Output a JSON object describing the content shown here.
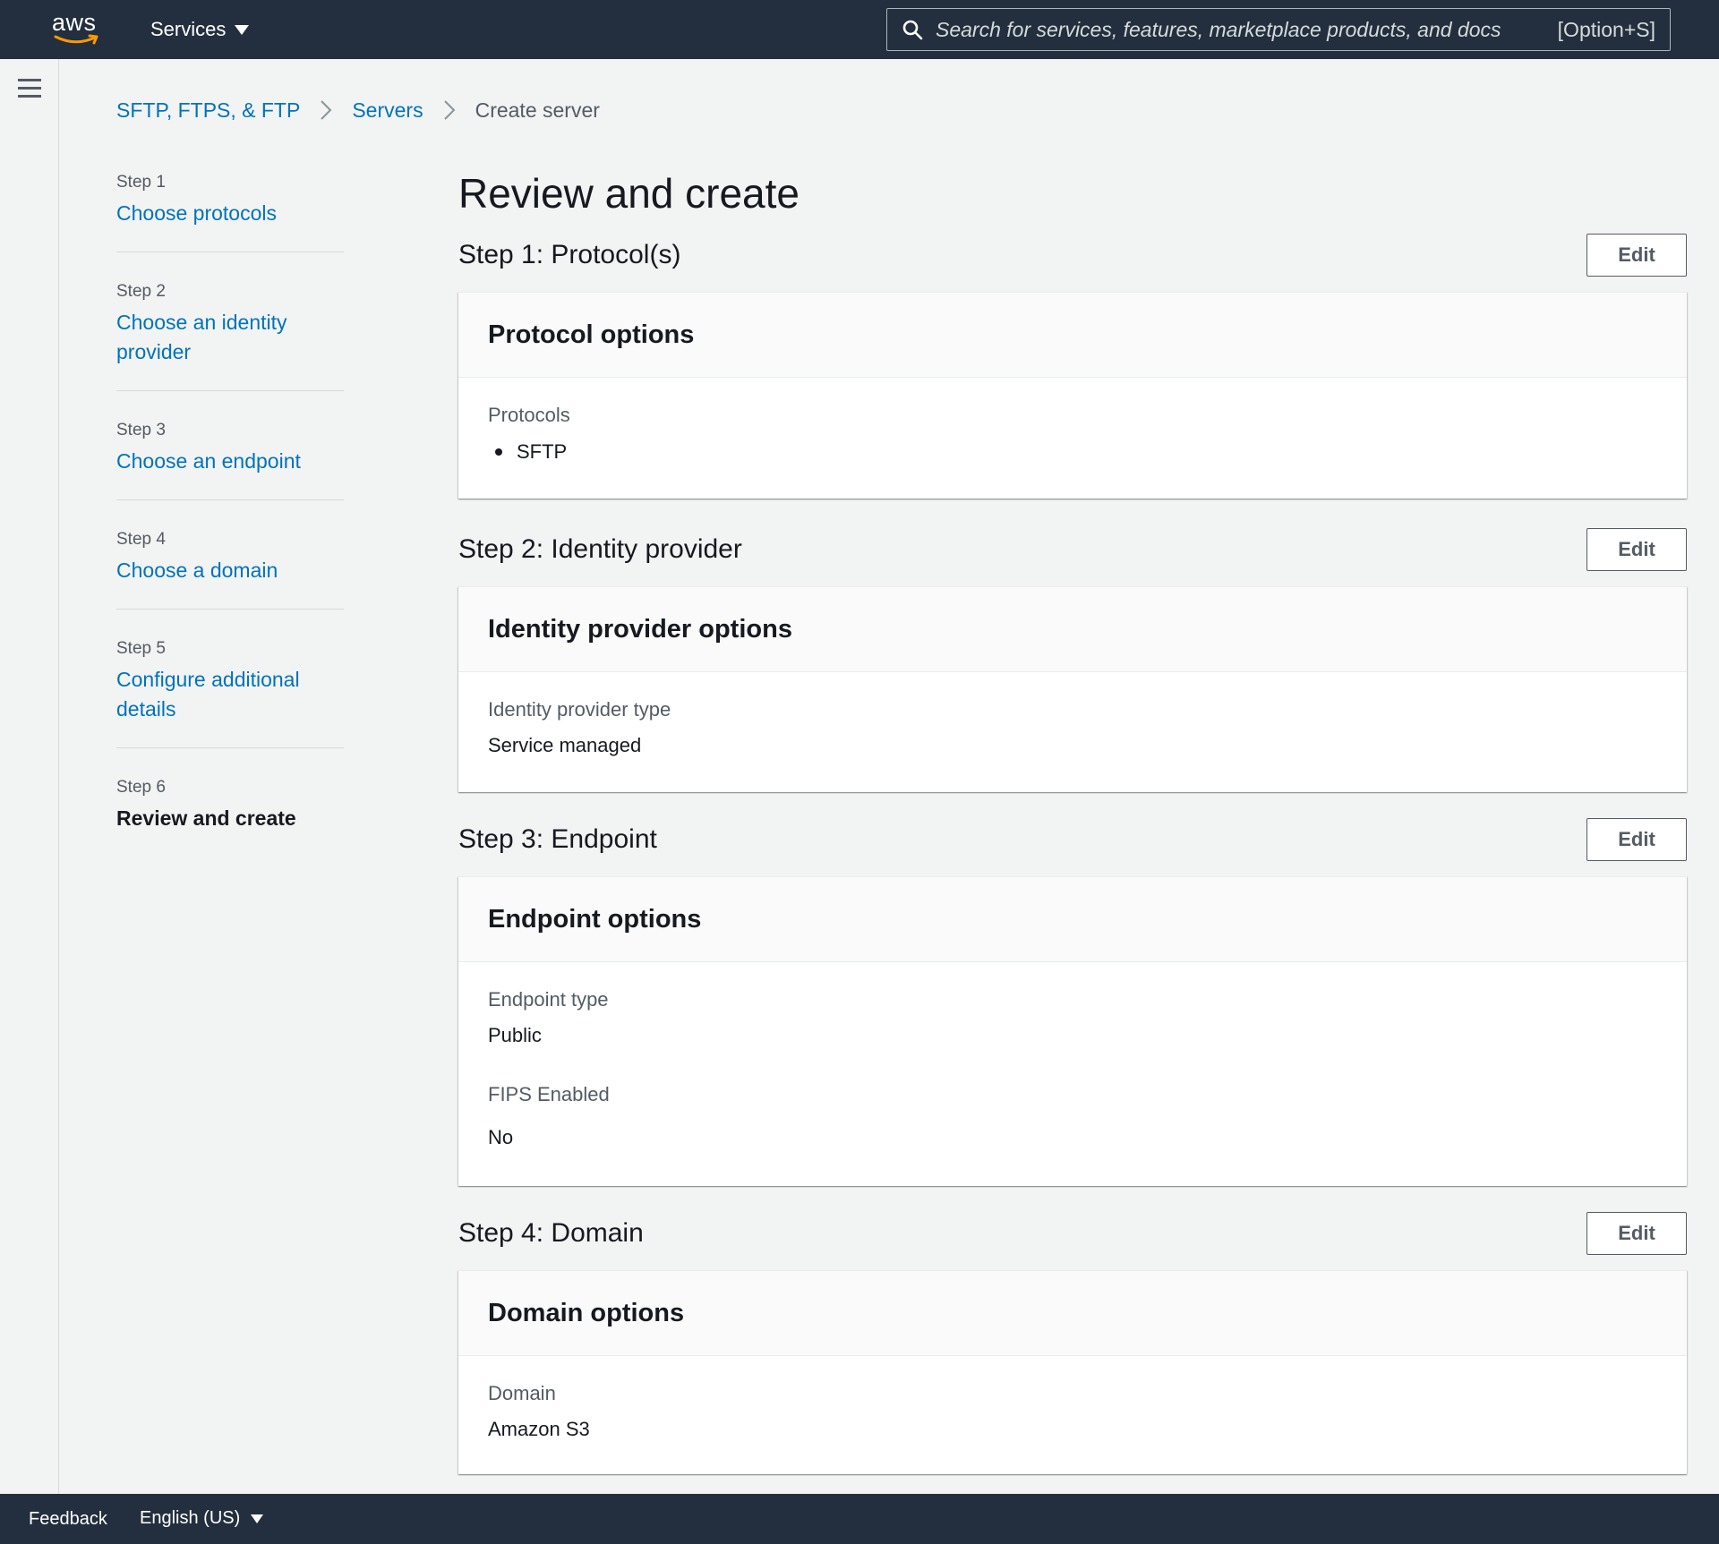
{
  "topnav": {
    "logo_text": "aws",
    "services_label": "Services",
    "search": {
      "placeholder": "Search for services, features, marketplace products, and docs",
      "shortcut": "[Option+S]"
    }
  },
  "breadcrumb": {
    "items": [
      "SFTP, FTPS, & FTP",
      "Servers"
    ],
    "current": "Create server"
  },
  "wizard": {
    "steps": [
      {
        "num": "Step 1",
        "label": "Choose protocols"
      },
      {
        "num": "Step 2",
        "label": "Choose an identity provider"
      },
      {
        "num": "Step 3",
        "label": "Choose an endpoint"
      },
      {
        "num": "Step 4",
        "label": "Choose a domain"
      },
      {
        "num": "Step 5",
        "label": "Configure additional details"
      },
      {
        "num": "Step 6",
        "label": "Review and create"
      }
    ]
  },
  "main": {
    "title": "Review and create",
    "edit_label": "Edit",
    "sections": [
      {
        "heading": "Step 1: Protocol(s)",
        "card_title": "Protocol options",
        "protocols_key": "Protocols",
        "protocols": [
          "SFTP"
        ]
      },
      {
        "heading": "Step 2: Identity provider",
        "card_title": "Identity provider options",
        "key": "Identity provider type",
        "value": "Service managed"
      },
      {
        "heading": "Step 3: Endpoint",
        "card_title": "Endpoint options",
        "endpoint_key": "Endpoint type",
        "endpoint_value": "Public",
        "fips_key": "FIPS Enabled",
        "fips_value": "No"
      },
      {
        "heading": "Step 4: Domain",
        "card_title": "Domain options",
        "key": "Domain",
        "value": "Amazon S3"
      }
    ]
  },
  "footer": {
    "feedback": "Feedback",
    "language": "English (US)"
  },
  "colors": {
    "nav_bg": "#232f3e",
    "link": "#0073bb",
    "page_bg": "#f2f3f3",
    "smile": "#ff9900"
  },
  "icons": [
    "hamburger-icon",
    "search-icon",
    "chevron-right-icon",
    "caret-down-icon",
    "aws-smile-icon"
  ]
}
